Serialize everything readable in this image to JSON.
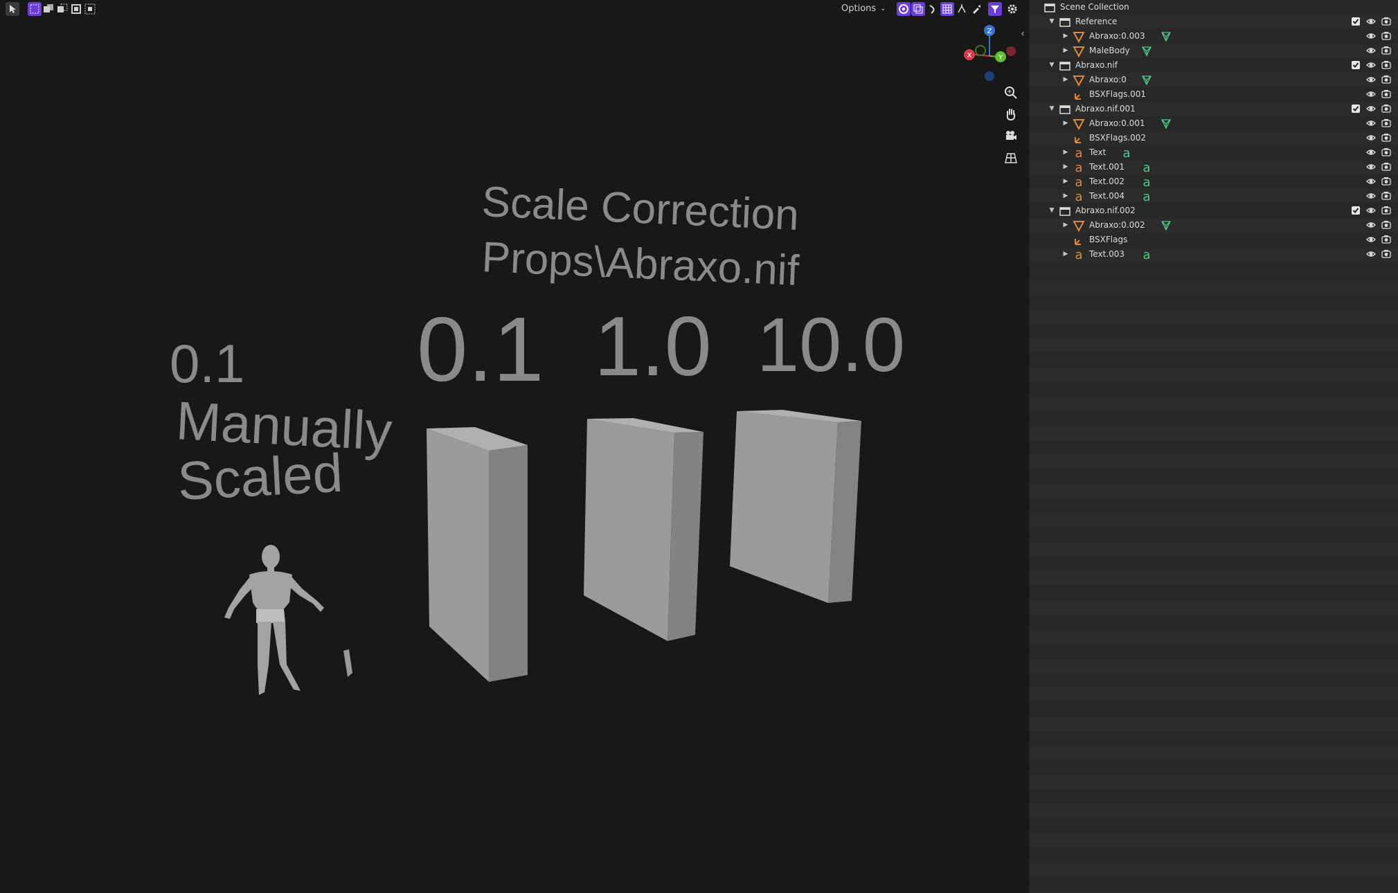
{
  "header": {
    "options_label": "Options"
  },
  "viewport": {
    "title_line1": "Scale Correction",
    "title_line2": "Props\\Abraxo.nif",
    "label_manual_value": "0.1",
    "label_manual_line1": "Manually",
    "label_manual_line2": "Scaled",
    "label_col1": "0.1",
    "label_col2": "1.0",
    "label_col3": "10.0",
    "gizmo": {
      "z": "Z",
      "x": "X",
      "y": "Y"
    }
  },
  "outliner": {
    "root_label": "Scene Collection",
    "rows": [
      {
        "label": "Reference",
        "kind": "collection",
        "depth": 0,
        "expanded": true,
        "checkbox": true
      },
      {
        "label": "Abraxo:0.003",
        "kind": "mesh",
        "depth": 1,
        "expanded": false,
        "extra": "mesh-data"
      },
      {
        "label": "MaleBody",
        "kind": "mesh",
        "depth": 1,
        "expanded": false,
        "extra": "mesh-data"
      },
      {
        "label": "Abraxo.nif",
        "kind": "collection",
        "depth": 0,
        "expanded": true,
        "checkbox": true
      },
      {
        "label": "Abraxo:0",
        "kind": "mesh",
        "depth": 1,
        "expanded": false,
        "extra": "mesh-data"
      },
      {
        "label": "BSXFlags.001",
        "kind": "empty",
        "depth": 1
      },
      {
        "label": "Abraxo.nif.001",
        "kind": "collection",
        "depth": 0,
        "expanded": true,
        "checkbox": true
      },
      {
        "label": "Abraxo:0.001",
        "kind": "mesh",
        "depth": 1,
        "expanded": false,
        "extra": "mesh-data"
      },
      {
        "label": "BSXFlags.002",
        "kind": "empty",
        "depth": 1
      },
      {
        "label": "Text",
        "kind": "text",
        "depth": 1,
        "expanded": false,
        "extra": "text-data"
      },
      {
        "label": "Text.001",
        "kind": "text",
        "depth": 1,
        "expanded": false,
        "extra": "text-data"
      },
      {
        "label": "Text.002",
        "kind": "text",
        "depth": 1,
        "expanded": false,
        "extra": "text-data"
      },
      {
        "label": "Text.004",
        "kind": "text",
        "depth": 1,
        "expanded": false,
        "extra": "text-data"
      },
      {
        "label": "Abraxo.nif.002",
        "kind": "collection",
        "depth": 0,
        "expanded": true,
        "checkbox": true
      },
      {
        "label": "Abraxo:0.002",
        "kind": "mesh",
        "depth": 1,
        "expanded": false,
        "extra": "mesh-data"
      },
      {
        "label": "BSXFlags",
        "kind": "empty",
        "depth": 1
      },
      {
        "label": "Text.003",
        "kind": "text",
        "depth": 1,
        "expanded": false,
        "extra": "text-data"
      }
    ]
  },
  "colors": {
    "accent": "#6b3fd6",
    "mesh_orange": "#e08a3c",
    "data_green": "#4fc98a",
    "viewport_bg": "#181818",
    "outliner_bg": "#282828"
  }
}
